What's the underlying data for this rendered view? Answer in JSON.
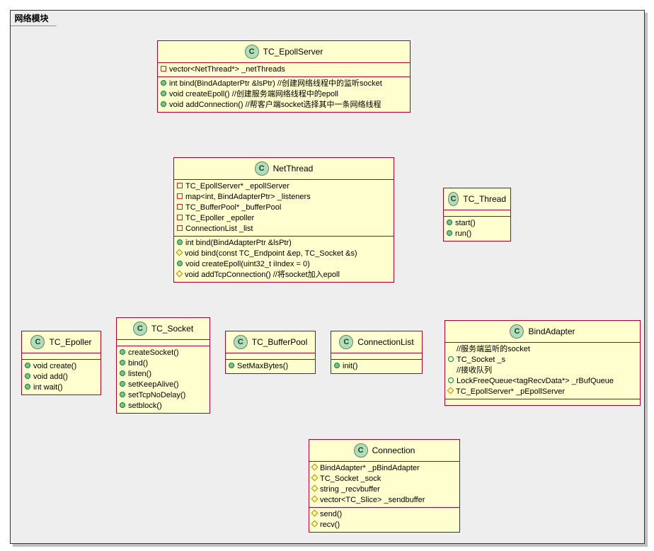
{
  "package": {
    "title": "网络模块"
  },
  "classes": {
    "TC_EpollServer": {
      "name": "TC_EpollServer",
      "fields": [
        {
          "vis": "private-square",
          "text": "vector<NetThread*> _netThreads"
        }
      ],
      "methods": [
        {
          "vis": "public-circle",
          "text": "int bind(BindAdapterPtr &lsPtr) //创建网络线程中的监听socket"
        },
        {
          "vis": "public-circle",
          "text": "void createEpoll() //创建服务端网络线程中的epoll"
        },
        {
          "vis": "public-circle",
          "text": "void addConnection() //帮客户端socket选择其中一条网络线程"
        }
      ]
    },
    "NetThread": {
      "name": "NetThread",
      "fields": [
        {
          "vis": "private-square",
          "text": "TC_EpollServer* _epollServer"
        },
        {
          "vis": "private-square",
          "text": "map<int, BindAdapterPtr> _listeners"
        },
        {
          "vis": "private-square",
          "text": "TC_BufferPool* _bufferPool"
        },
        {
          "vis": "private-square",
          "text": "TC_Epoller _epoller"
        },
        {
          "vis": "private-square",
          "text": "ConnectionList _list"
        }
      ],
      "methods": [
        {
          "vis": "public-circle",
          "text": "int bind(BindAdapterPtr &lsPtr)"
        },
        {
          "vis": "protected-diamond",
          "text": "void bind(const TC_Endpoint &ep, TC_Socket &s)"
        },
        {
          "vis": "public-circle",
          "text": "void createEpoll(uint32_t iIndex = 0)"
        },
        {
          "vis": "protected-diamond",
          "text": "void addTcpConnection() //将socket加入epoll"
        }
      ]
    },
    "TC_Thread": {
      "name": "TC_Thread",
      "methods": [
        {
          "vis": "public-circle",
          "text": "start()"
        },
        {
          "vis": "public-circle",
          "text": "run()"
        }
      ]
    },
    "TC_Epoller": {
      "name": "TC_Epoller",
      "methods": [
        {
          "vis": "public-circle",
          "text": "void create()"
        },
        {
          "vis": "public-circle",
          "text": "void add()"
        },
        {
          "vis": "public-circle",
          "text": "int wait()"
        }
      ]
    },
    "TC_Socket": {
      "name": "TC_Socket",
      "methods": [
        {
          "vis": "public-circle",
          "text": "createSocket()"
        },
        {
          "vis": "public-circle",
          "text": "bind()"
        },
        {
          "vis": "public-circle",
          "text": "listen()"
        },
        {
          "vis": "public-circle",
          "text": "setKeepAlive()"
        },
        {
          "vis": "public-circle",
          "text": "setTcpNoDelay()"
        },
        {
          "vis": "public-circle",
          "text": "setblock()"
        }
      ]
    },
    "TC_BufferPool": {
      "name": "TC_BufferPool",
      "methods": [
        {
          "vis": "public-circle",
          "text": "SetMaxBytes()"
        }
      ]
    },
    "ConnectionList": {
      "name": "ConnectionList",
      "methods": [
        {
          "vis": "public-circle",
          "text": "init()"
        }
      ]
    },
    "BindAdapter": {
      "name": "BindAdapter",
      "fields": [
        {
          "vis": "none",
          "text": "//服务端监听的socket"
        },
        {
          "vis": "package-circle",
          "text": "TC_Socket _s"
        },
        {
          "vis": "none",
          "text": "//接收队列"
        },
        {
          "vis": "package-circle",
          "text": "LockFreeQueue<tagRecvData*> _rBufQueue"
        },
        {
          "vis": "protected-diamond",
          "text": "TC_EpollServer* _pEpollServer"
        }
      ]
    },
    "Connection": {
      "name": "Connection",
      "fields": [
        {
          "vis": "protected-diamond",
          "text": "BindAdapter* _pBindAdapter"
        },
        {
          "vis": "protected-diamond",
          "text": "TC_Socket _sock"
        },
        {
          "vis": "protected-diamond",
          "text": "string _recvbuffer"
        },
        {
          "vis": "protected-diamond",
          "text": "vector<TC_Slice> _sendbuffer"
        }
      ],
      "methods": [
        {
          "vis": "protected-diamond",
          "text": "send()"
        },
        {
          "vis": "protected-diamond",
          "text": "recv()"
        }
      ]
    }
  }
}
